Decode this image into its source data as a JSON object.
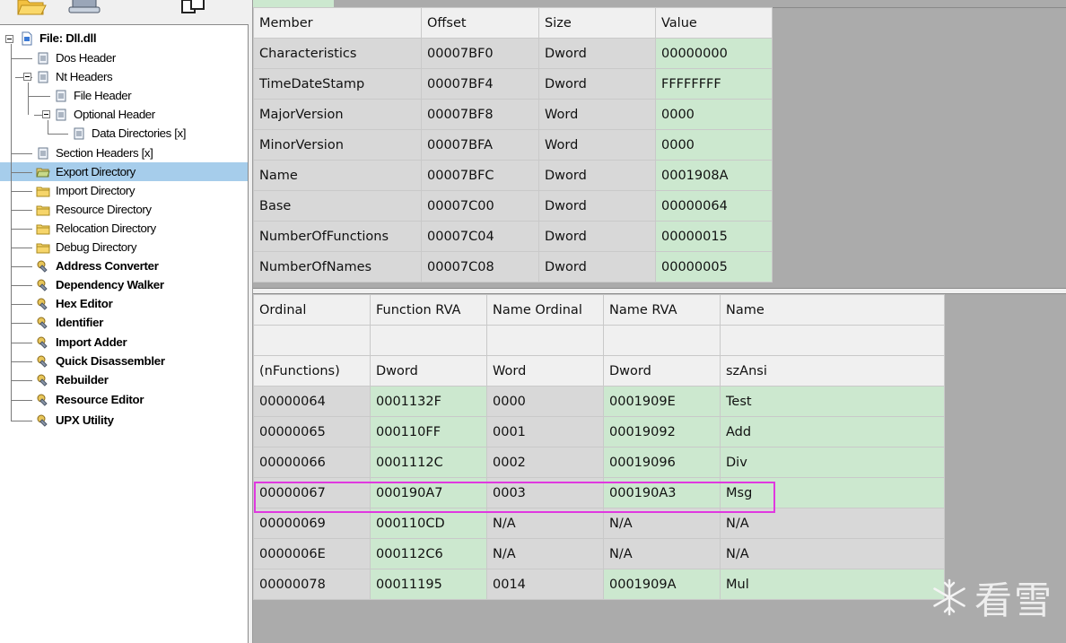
{
  "tree": {
    "root": "File: Dll.dll",
    "items": [
      {
        "label": "Dos Header"
      },
      {
        "label": "Nt Headers"
      },
      {
        "label": "File Header"
      },
      {
        "label": "Optional Header"
      },
      {
        "label": "Data Directories [x]"
      },
      {
        "label": "Section Headers [x]"
      },
      {
        "label": "Export Directory"
      },
      {
        "label": "Import Directory"
      },
      {
        "label": "Resource Directory"
      },
      {
        "label": "Relocation Directory"
      },
      {
        "label": "Debug Directory"
      },
      {
        "label": "Address Converter"
      },
      {
        "label": "Dependency Walker"
      },
      {
        "label": "Hex Editor"
      },
      {
        "label": "Identifier"
      },
      {
        "label": "Import Adder"
      },
      {
        "label": "Quick Disassembler"
      },
      {
        "label": "Rebuilder"
      },
      {
        "label": "Resource Editor"
      },
      {
        "label": "UPX Utility"
      }
    ],
    "selected": "Export Directory"
  },
  "export_table": {
    "headers": [
      "Member",
      "Offset",
      "Size",
      "Value"
    ],
    "rows": [
      [
        "Characteristics",
        "00007BF0",
        "Dword",
        "00000000"
      ],
      [
        "TimeDateStamp",
        "00007BF4",
        "Dword",
        "FFFFFFFF"
      ],
      [
        "MajorVersion",
        "00007BF8",
        "Word",
        "0000"
      ],
      [
        "MinorVersion",
        "00007BFA",
        "Word",
        "0000"
      ],
      [
        "Name",
        "00007BFC",
        "Dword",
        "0001908A"
      ],
      [
        "Base",
        "00007C00",
        "Dword",
        "00000064"
      ],
      [
        "NumberOfFunctions",
        "00007C04",
        "Dword",
        "00000015"
      ],
      [
        "NumberOfNames",
        "00007C08",
        "Dword",
        "00000005"
      ]
    ]
  },
  "functions_table": {
    "headers": [
      "Ordinal",
      "Function RVA",
      "Name Ordinal",
      "Name RVA",
      "Name"
    ],
    "blank_row": [
      "",
      "",
      "",
      "",
      ""
    ],
    "type_row": [
      "(nFunctions)",
      "Dword",
      "Word",
      "Dword",
      "szAnsi"
    ],
    "rows": [
      [
        "00000064",
        "0001132F",
        "0000",
        "0001909E",
        "Test"
      ],
      [
        "00000065",
        "000110FF",
        "0001",
        "00019092",
        "Add"
      ],
      [
        "00000066",
        "0001112C",
        "0002",
        "00019096",
        "Div"
      ],
      [
        "00000067",
        "000190A7",
        "0003",
        "000190A3",
        "Msg"
      ],
      [
        "00000069",
        "000110CD",
        "N/A",
        "N/A",
        "N/A"
      ],
      [
        "0000006E",
        "000112C6",
        "N/A",
        "N/A",
        "N/A"
      ],
      [
        "00000078",
        "00011195",
        "0014",
        "0001909A",
        "Mul"
      ]
    ],
    "highlighted_row": "00000067"
  },
  "watermark": {
    "text": "看雪"
  },
  "colors": {
    "value_green": "#cce8cf",
    "header_gray": "#f0f0f0",
    "row_gray": "#d8d8d8",
    "selection_blue": "#a6cdeb",
    "highlight_magenta": "#e038e0"
  }
}
